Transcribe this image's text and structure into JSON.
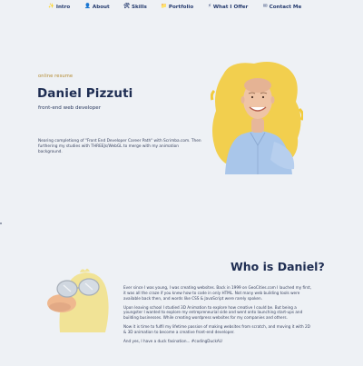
{
  "nav": {
    "items": [
      {
        "label": "Intro",
        "icon": "sparkle-icon"
      },
      {
        "label": "About",
        "icon": "person-icon"
      },
      {
        "label": "Skills",
        "icon": "tools-icon"
      },
      {
        "label": "Portfolio",
        "icon": "folder-icon"
      },
      {
        "label": "What I Offer",
        "icon": "lightning-icon"
      },
      {
        "label": "Contact Me",
        "icon": "envelope-icon"
      }
    ]
  },
  "hero": {
    "kicker": "online resume",
    "name": "Daniel Pizzuti",
    "role": "front-end web developer",
    "blurb": "Nearing completiong of \"Front End Developer Career Path\" with Scrimba.com. Then furthering my studies with THREEJs/WebGL to merge with my animation background."
  },
  "who": {
    "title": "Who is Daniel?",
    "paragraphs": [
      "Ever since I was young, I was creating websites. Back in 1999 on GeoCities.com I lauched my first, it was all the craze if you knew how to code in only HTML. Not many web building tools were available back then, and words like CSS & JavaScript were rarely spoken.",
      "Upon leaving school I studied 3D Animation to explore how creative I could be. But being a youngster I wanted to explore my entrepreneurial side and went onto launching start-ups and building businesses. While creating wordpress websites for my companies and others.",
      "Now it is time to fulfil my lifetime passion of making websites from scratch, and moving it with 2D & 3D animation to become a creative front-end developer.",
      "And yes, I have a duck fasination... #codingDuckAU"
    ]
  },
  "colors": {
    "background": "#eef1f5",
    "nav_text": "#243a6e",
    "heading": "#1e2d52",
    "kicker": "#b3892e",
    "paint_splash": "#f2cb3c"
  }
}
